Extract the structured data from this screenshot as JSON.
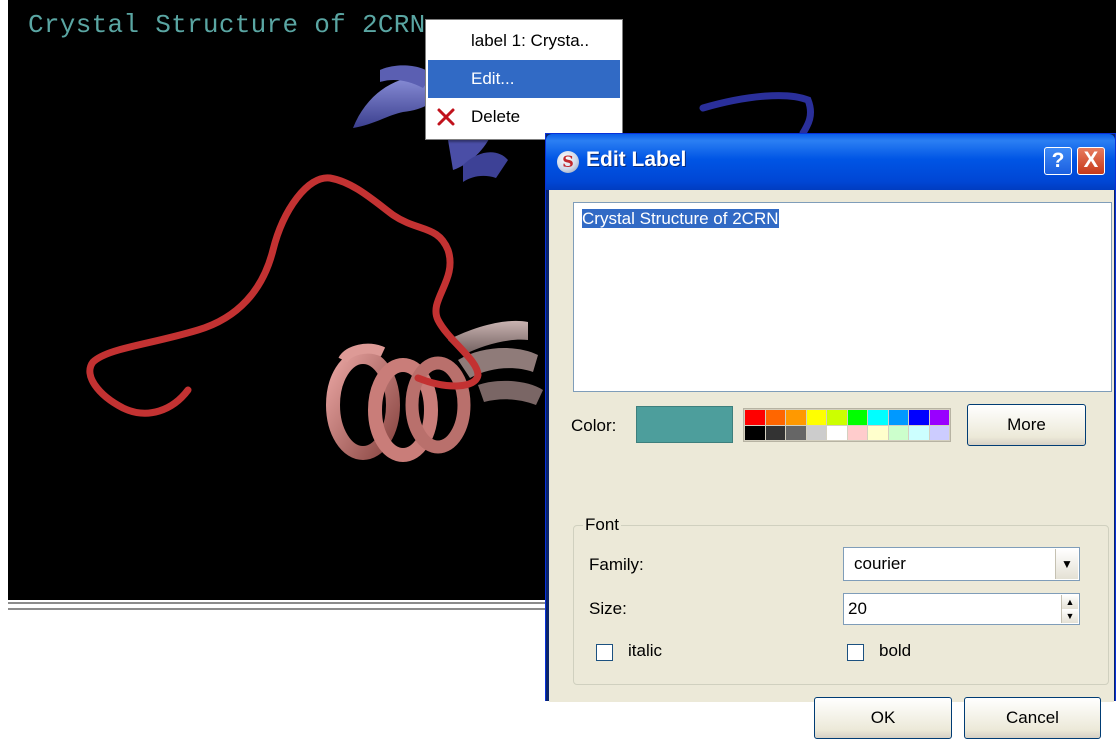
{
  "viewer": {
    "label_text": "Crystal Structure of 2CRN",
    "label_color": "#5aa6a3"
  },
  "context_menu": {
    "items": [
      {
        "label": "label 1: Crysta..",
        "icon": ""
      },
      {
        "label": "Edit...",
        "icon": ""
      },
      {
        "label": "Delete",
        "icon": "delete-x-icon"
      }
    ],
    "active_index": 1
  },
  "dialog": {
    "title": "Edit Label",
    "title_icon": "chimera-app-icon",
    "help_button": "?",
    "close_button": "X",
    "text_value": "Crystal Structure of 2CRN",
    "color_label": "Color:",
    "current_color": "#4d9e9c",
    "palette": [
      "#ff0000",
      "#ff6600",
      "#ff9900",
      "#ffff00",
      "#ccff00",
      "#00ff00",
      "#00ffff",
      "#0099ff",
      "#0000ff",
      "#9900ff",
      "#000000",
      "#333333",
      "#666666",
      "#cccccc",
      "#ffffff",
      "#ffcccc",
      "#ffffcc",
      "#ccffcc",
      "#ccffff",
      "#ccccff"
    ],
    "more_button": "More",
    "font_group": {
      "legend": "Font",
      "family_label": "Family:",
      "family_value": "courier",
      "size_label": "Size:",
      "size_value": "20",
      "italic_label": "italic",
      "italic_checked": false,
      "bold_label": "bold",
      "bold_checked": false
    },
    "ok_button": "OK",
    "cancel_button": "Cancel"
  }
}
